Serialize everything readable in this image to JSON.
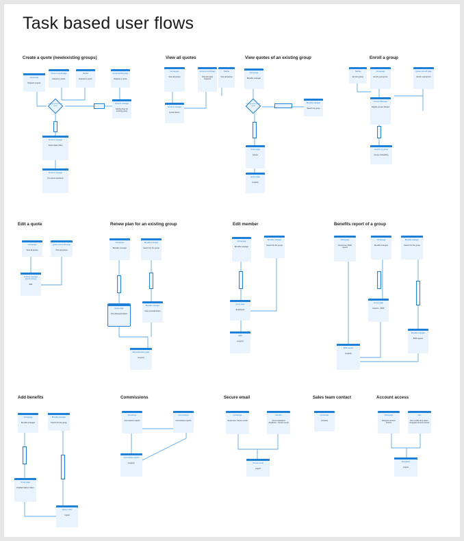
{
  "page_title": "Task based user flows",
  "flows": [
    {
      "title": "Create a quote (new/existing groups)",
      "cards": [
        {
          "h": "Homepage",
          "b": "Request a quote"
        },
        {
          "h": "Quote & enroll page",
          "b": "Request a quote"
        },
        {
          "h": "Navbar",
          "b": "Request a quote"
        },
        {
          "h": "Group landing page",
          "b": "Request a quote"
        },
        {
          "h": "Account manager",
          "b": "Starting flow for existing group"
        },
        {
          "h": "Account manager",
          "b": "Select sales office"
        },
        {
          "h": "Account manager",
          "b": "Pre-quote questions"
        }
      ]
    },
    {
      "title": "View all quotes",
      "cards": [
        {
          "h": "Homepage",
          "b": "View all quotes"
        },
        {
          "h": "Quote & enroll page",
          "b": "View all quote requests"
        },
        {
          "h": "Navbar",
          "b": "View all quotes"
        },
        {
          "h": "Account manager",
          "b": "Quote history"
        }
      ]
    },
    {
      "title": "View quotes of an existing group",
      "cards": [
        {
          "h": "Homepage",
          "b": "Benefits manager"
        },
        {
          "h": "Benefits manager",
          "b": "Search for group"
        },
        {
          "h": "Group page",
          "b": "Quotes"
        },
        {
          "h": "Quote page",
          "b": "(Logout)"
        }
      ]
    },
    {
      "title": "Enroll a group",
      "cards": [
        {
          "h": "Navbar",
          "b": "Enroll a group"
        },
        {
          "h": "Homepage",
          "b": "Enroll a group link"
        },
        {
          "h": "Quote & Enroll page",
          "b": "Enroll a group link"
        },
        {
          "h": "Account Manager",
          "b": "Eligible groups filtered"
        },
        {
          "h": "Launch my group",
          "b": "Group onboarding"
        }
      ]
    },
    {
      "title": "Edit a quote",
      "cards": [
        {
          "h": "Homepage",
          "b": "View all quotes"
        },
        {
          "h": "Quote and enroll page",
          "b": "View all quotes"
        },
        {
          "h": "Account manager (quote history)",
          "b": "Edit"
        }
      ]
    },
    {
      "title": "Renew plan for an existing group",
      "cards": [
        {
          "h": "Homepage",
          "b": "Benefits manager"
        },
        {
          "h": "Benefits manager",
          "b": "Search for the group"
        },
        {
          "h": "group page",
          "b": "View Renewal letters"
        },
        {
          "h": "Benefits manager",
          "b": "View renewal letters"
        },
        {
          "h": "Renewal letters page",
          "b": "(Logout)"
        }
      ]
    },
    {
      "title": "Edit member",
      "cards": [
        {
          "h": "Homepage",
          "b": "Benefits manager"
        },
        {
          "h": "Benefits manager",
          "b": "Search for the group"
        },
        {
          "h": "group page",
          "b": "Employees"
        },
        {
          "h": "HRIS",
          "b": "(Logout)"
        }
      ]
    },
    {
      "title": "Benefits report of  a group",
      "cards": [
        {
          "h": "Homepage",
          "b": "Resources: BOR reports"
        },
        {
          "h": "Homepage",
          "b": "Benefits manager"
        },
        {
          "h": "Benefits manager",
          "b": "Search for the group"
        },
        {
          "h": "Group page",
          "b": "Reports - BOR"
        },
        {
          "h": "Benefits manager",
          "b": "BOR reports"
        },
        {
          "h": "BOR reports",
          "b": "(Logout)"
        }
      ]
    },
    {
      "title": "Add benefits",
      "cards": [
        {
          "h": "Homepage",
          "b": "Benefits manager"
        },
        {
          "h": "Benefits manager",
          "b": "Search for the group"
        },
        {
          "h": "Group page",
          "b": "Enabled add-on riders"
        },
        {
          "h": "Add-on rider",
          "b": "Logout"
        }
      ]
    },
    {
      "title": "Commissions",
      "cards": [
        {
          "h": "Homepage",
          "b": "Commission reports"
        },
        {
          "h": "Commissions",
          "b": "Commission reports"
        },
        {
          "h": "Commission reports",
          "b": "(Logout)"
        }
      ]
    },
    {
      "title": "Secure email",
      "cards": [
        {
          "h": "Homepage",
          "b": "Resources: Secure email"
        },
        {
          "h": "Nav Bar",
          "b": "Communications dropdown - Secure email"
        },
        {
          "h": "Secure email",
          "b": "Logout"
        }
      ]
    },
    {
      "title": "Sales team contact",
      "cards": [
        {
          "h": "Homepage",
          "b": "Contacts"
        }
      ]
    },
    {
      "title": "Account access",
      "cards": [
        {
          "h": "Homepage",
          "b": "Delegate account access"
        },
        {
          "h": "Nav",
          "b": "User profile drop down - Delegate account access"
        },
        {
          "h": "Delegation",
          "b": "Logout"
        }
      ]
    }
  ],
  "decisions": [
    {
      "label": "Existing group or new group"
    },
    {
      "label": "Existing group or new group"
    }
  ],
  "colors": {
    "accent": "#1d7fd6",
    "card_fill": "#e8f3fd",
    "connector": "#5aaae6"
  }
}
